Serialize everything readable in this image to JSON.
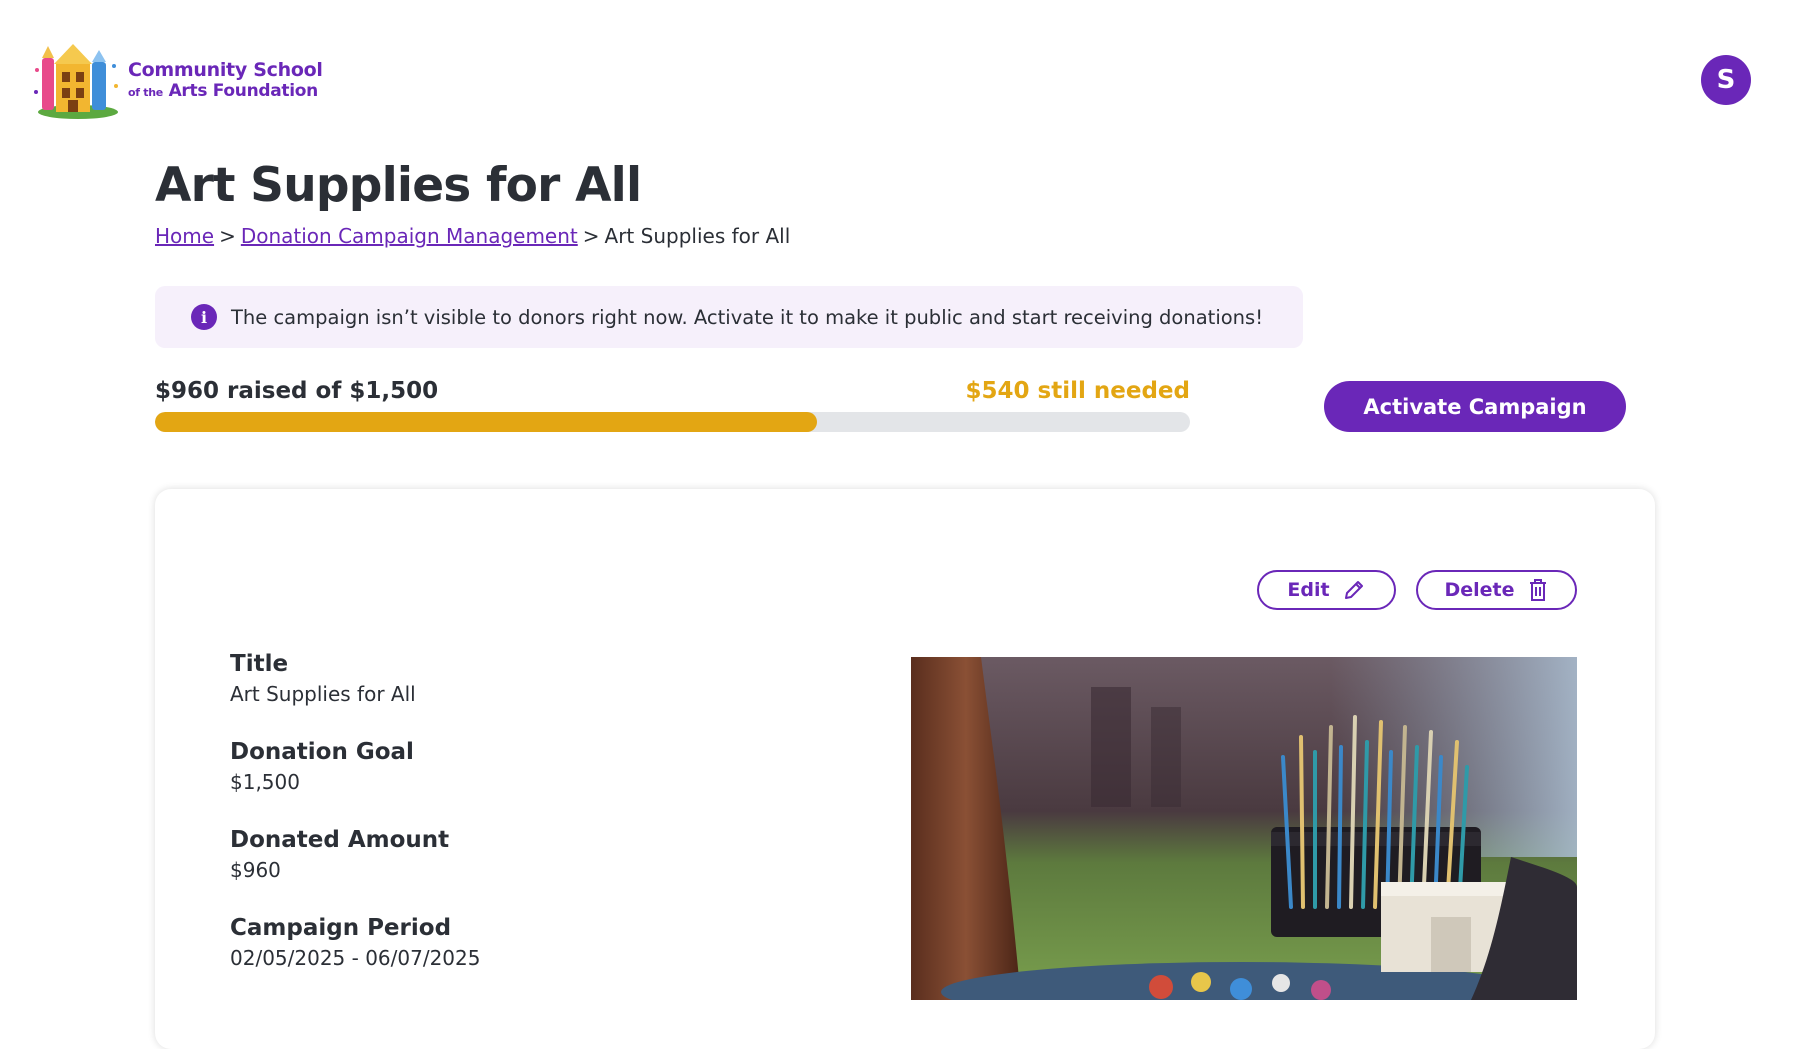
{
  "header": {
    "logo_line1": "Community School",
    "logo_line2_small": "of the",
    "logo_line2": "Arts Foundation",
    "avatar_initial": "S"
  },
  "page": {
    "title": "Art Supplies for All"
  },
  "breadcrumb": {
    "items": [
      "Home",
      "Donation Campaign Management",
      "Art Supplies for All"
    ],
    "separator": ">"
  },
  "notice": {
    "icon": "info-icon",
    "icon_glyph": "i",
    "text": "The campaign isn’t visible to donors right now. Activate it to make it public and start receiving donations!"
  },
  "progress": {
    "raised_text": "$960 raised of $1,500",
    "needed_text": "$540 still needed",
    "fraction": 0.64
  },
  "actions": {
    "activate_label": "Activate Campaign",
    "edit_label": "Edit",
    "delete_label": "Delete"
  },
  "details": {
    "title_label": "Title",
    "title_value": "Art Supplies for All",
    "goal_label": "Donation Goal",
    "goal_value": "$1,500",
    "donated_label": "Donated Amount",
    "donated_value": "$960",
    "period_label": "Campaign Period",
    "period_value": "02/05/2025 - 06/07/2025"
  },
  "colors": {
    "brand_purple": "#6a27b8",
    "accent_gold": "#e3a613",
    "notice_bg": "#f6f0fb",
    "track_gray": "#e3e5e8"
  }
}
